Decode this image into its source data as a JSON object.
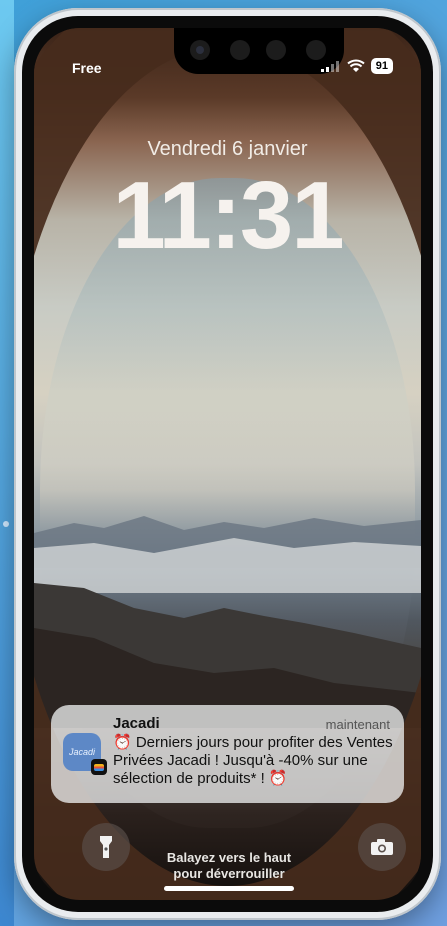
{
  "status_bar": {
    "carrier": "Free",
    "battery": "91"
  },
  "lock_screen": {
    "date": "Vendredi 6 janvier",
    "time": "11:31"
  },
  "notification": {
    "app_name": "Jacadi",
    "time": "maintenant",
    "body": "⏰ Derniers jours pour profiter des Ventes Privées Jacadi ! Jusqu'à -40% sur une sélection de produits* ! ⏰",
    "icon_text": "Jacadi"
  },
  "bottom": {
    "swipe_line1": "Balayez vers le haut",
    "swipe_line2": "pour déverrouiller"
  },
  "icons": {
    "left": "flashlight-icon",
    "right": "camera-icon"
  }
}
